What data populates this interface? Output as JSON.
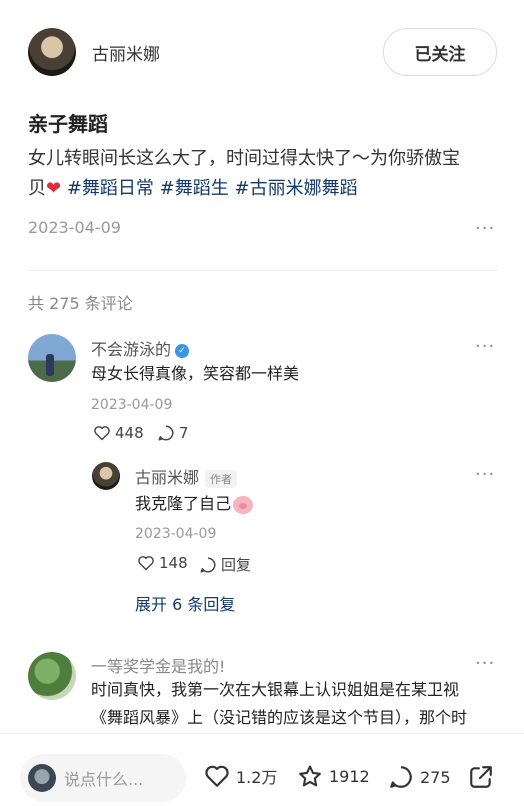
{
  "author": {
    "name": "古丽米娜",
    "follow_label": "已关注"
  },
  "post": {
    "title": "亲子舞蹈",
    "text_line1": "女儿转眼间长这么大了，时间过得太快了～为你骄傲宝",
    "text_line2_prefix": "贝",
    "tags": [
      "#舞蹈日常",
      "#舞蹈生",
      "#古丽米娜舞蹈"
    ],
    "date": "2023-04-09"
  },
  "comments_header": {
    "count_text": "共 275 条评论"
  },
  "comments": [
    {
      "name": "不会游泳的",
      "text": "母女长得真像，笑容都一样美",
      "date": "2023-04-09",
      "likes": "448",
      "replies": "7"
    }
  ],
  "reply": {
    "name": "古丽米娜",
    "author_tag": "作者",
    "text": "我克隆了自己",
    "date": "2023-04-09",
    "likes": "148",
    "reply_label": "回复",
    "expand_label": "展开 6 条回复"
  },
  "comment2": {
    "name": "一等奖学金是我的!",
    "line1": "时间真快，我第一次在大银幕上认识姐姐是在某卫视",
    "line2": "《舞蹈风暴》上（没记错的应该是这个节目），那个时"
  },
  "bottom_bar": {
    "input_placeholder": "说点什么...",
    "likes": "1.2万",
    "favorites": "1912",
    "comments": "275"
  },
  "icons": {
    "heart": "heart-icon",
    "star": "star-icon",
    "comment": "comment-bubble-icon",
    "share": "share-icon",
    "more": "more-dots-icon"
  },
  "colors": {
    "tag": "#13386c",
    "verify_badge": "#3a95e4",
    "heart_emoji": "#e02a3f"
  }
}
